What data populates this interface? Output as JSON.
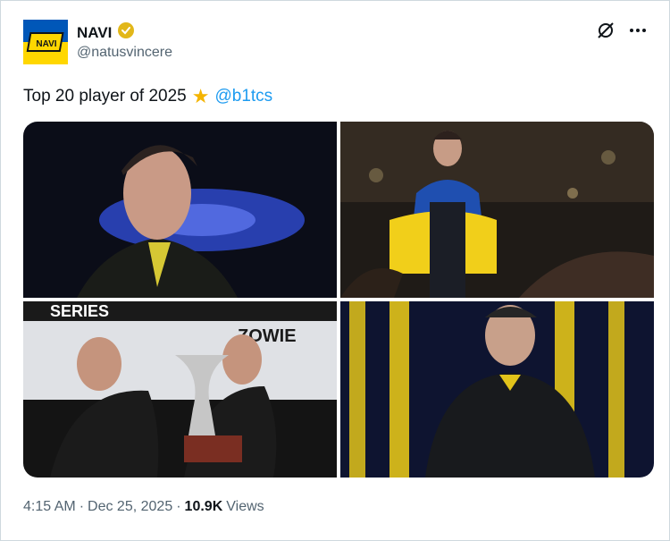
{
  "author": {
    "display_name": "NAVI",
    "handle": "@natusvincere",
    "verified_badge": "gold-verified-badge-icon",
    "avatar_text": "NAVI",
    "avatar_colors": {
      "top": "#0057b8",
      "bottom": "#ffd700"
    }
  },
  "tweet": {
    "text": "Top 20 player of 2025",
    "emoji": "★",
    "mention": "@b1tcs"
  },
  "media": {
    "photos": [
      {
        "label": "Player portrait on stage with blue light"
      },
      {
        "label": "Player walking with Ukrainian flag"
      },
      {
        "label": "Team lifting trophy",
        "banner_text": "ZOWIE",
        "banner_text2": "SERIES"
      },
      {
        "label": "Player portrait with yellow stripes"
      }
    ]
  },
  "meta": {
    "time": "4:15 AM",
    "sep": "·",
    "date": "Dec 25, 2025",
    "sep2": "·",
    "views_count": "10.9K",
    "views_label": "Views"
  },
  "colors": {
    "mention": "#1d9bf0",
    "text": "#0f1419",
    "muted": "#536471"
  }
}
